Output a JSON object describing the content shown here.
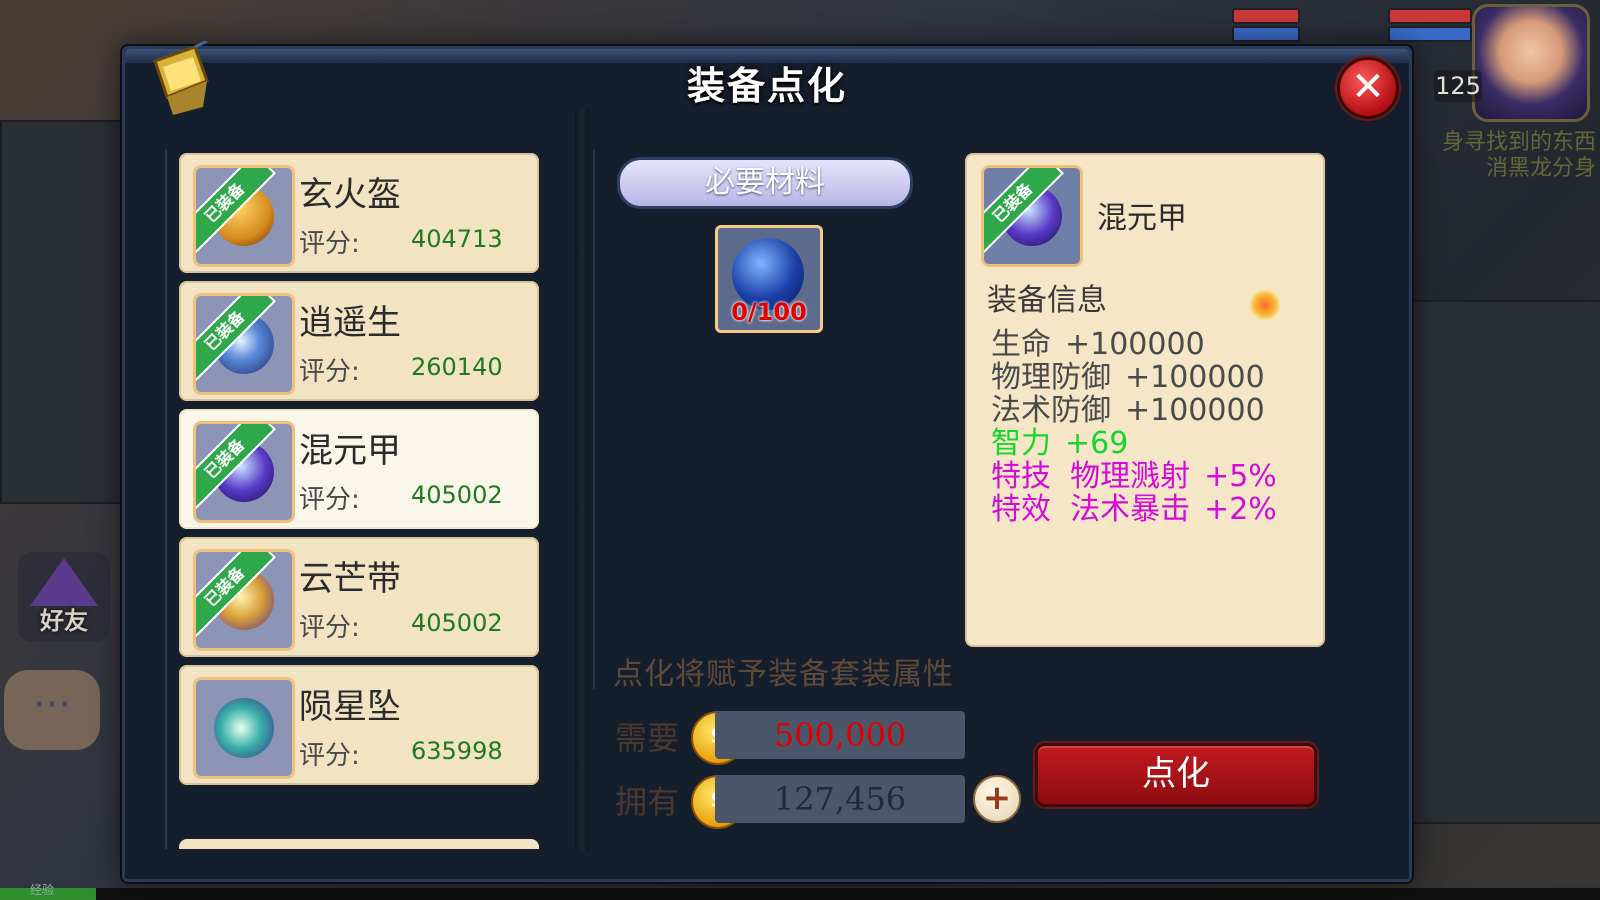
{
  "panel": {
    "title": "装备点化"
  },
  "hud": {
    "level": "125",
    "quest_line1": "身寻找到的东西",
    "quest_line2": "消黑龙分身",
    "friend_label": "好友",
    "chat_label": "···",
    "exp_label": "经验"
  },
  "items": [
    {
      "name": "玄火盔",
      "score_label": "评分:",
      "score": "404713",
      "equipped_tag": "已装备",
      "equipped": true,
      "selected": false,
      "icon": "helmet-icon",
      "color": "#d68a1e"
    },
    {
      "name": "逍遥生",
      "score_label": "评分:",
      "score": "260140",
      "equipped_tag": "已装备",
      "equipped": true,
      "selected": false,
      "icon": "weapon-icon",
      "color": "#2a4a9a"
    },
    {
      "name": "混元甲",
      "score_label": "评分:",
      "score": "405002",
      "equipped_tag": "已装备",
      "equipped": true,
      "selected": true,
      "icon": "armor-icon",
      "color": "#5a3ac8"
    },
    {
      "name": "云芒带",
      "score_label": "评分:",
      "score": "405002",
      "equipped_tag": "已装备",
      "equipped": true,
      "selected": false,
      "icon": "belt-icon",
      "color": "#d8a23a"
    },
    {
      "name": "陨星坠",
      "score_label": "评分:",
      "score": "635998",
      "equipped_tag": "",
      "equipped": false,
      "selected": false,
      "icon": "necklace-icon",
      "color": "#3ab0a8"
    }
  ],
  "materials": {
    "header": "必要材料",
    "item_count": "0/100",
    "icon": "thunder-orb-icon"
  },
  "hint": "点化将赋予装备套装属性",
  "cost": {
    "need_label": "需要",
    "need_value": "500,000",
    "have_label": "拥有",
    "have_value": "127,456",
    "coin_icon": "gold-coin-icon"
  },
  "action_label": "点化",
  "info": {
    "name": "混元甲",
    "equipped_tag": "已装备",
    "section_title": "装备信息",
    "attributes": [
      {
        "name": "生命",
        "value": "+100000",
        "kind": "base"
      },
      {
        "name": "物理防御",
        "value": "+100000",
        "kind": "base"
      },
      {
        "name": "法术防御",
        "value": "+100000",
        "kind": "base"
      },
      {
        "name": "智力",
        "value": "+69",
        "kind": "green"
      },
      {
        "name": "特技  物理溅射",
        "value": "+5%",
        "kind": "purple"
      },
      {
        "name": "特效  法术暴击",
        "value": "+2%",
        "kind": "purple"
      }
    ]
  },
  "colors": {
    "panel_bg": "#141e2c",
    "card_bg": "#f2e3c3",
    "equipped_green": "#2ea84a",
    "score_green": "#1e7a1e",
    "need_red": "#e00000",
    "action_red": "#b4141a",
    "attr_green": "#19d42d",
    "attr_purple": "#d40cd6"
  }
}
